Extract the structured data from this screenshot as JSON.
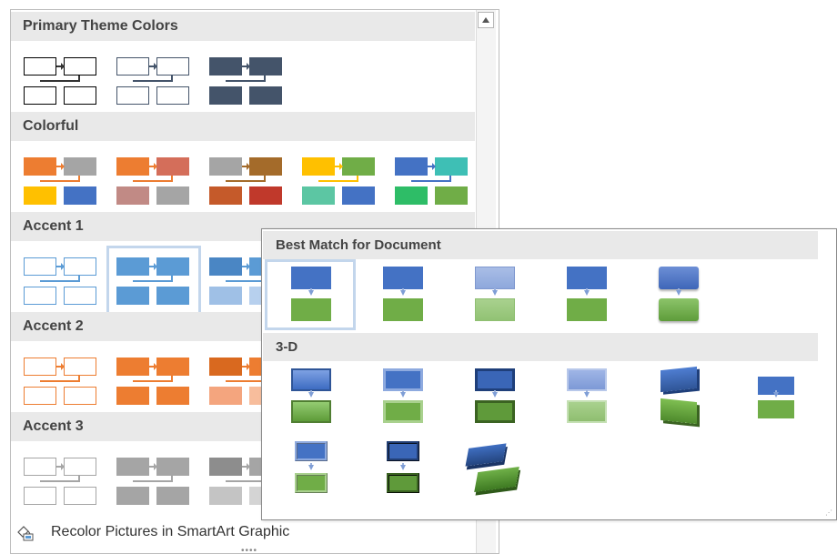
{
  "color_gallery": {
    "sections": [
      {
        "title": "Primary Theme Colors"
      },
      {
        "title": "Colorful"
      },
      {
        "title": "Accent 1"
      },
      {
        "title": "Accent 2"
      },
      {
        "title": "Accent 3"
      }
    ],
    "recolor_label": "Recolor Pictures in SmartArt Graphic",
    "scroll_up_icon": "triangle-up-icon"
  },
  "style_gallery": {
    "sections": [
      {
        "title": "Best Match for Document"
      },
      {
        "title": "3-D"
      }
    ]
  },
  "colors": {
    "selection": "#c3d6ec",
    "blue": "#4472c4",
    "green": "#70ad47",
    "orange": "#ed7d31",
    "gray": "#a5a5a5",
    "gold": "#ffc000",
    "accent1_line": "#5b9bd5"
  }
}
